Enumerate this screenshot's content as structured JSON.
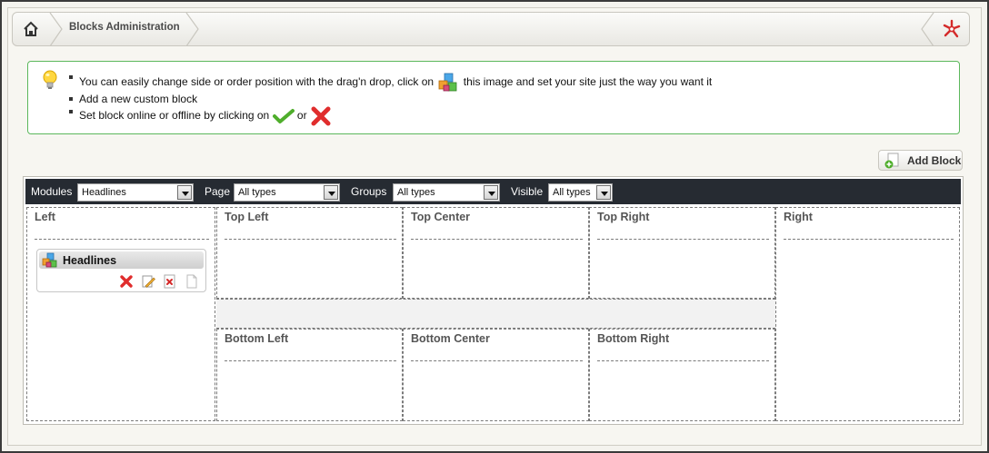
{
  "breadcrumb": {
    "title": "Blocks Administration"
  },
  "info": {
    "line1_before": "You can easily change side or order position with the drag'n drop, click on",
    "line1_after": "this image and set your site just the way you want it",
    "line2": "Add a new custom block",
    "line3_before": "Set block online or offline by clicking on",
    "line3_or": "or"
  },
  "toolbar": {
    "add_block_label": "Add Block"
  },
  "filters": {
    "modules_label": "Modules",
    "modules_value": "Headlines",
    "page_label": "Page",
    "page_value": "All types",
    "groups_label": "Groups",
    "groups_value": "All types",
    "visible_label": "Visible",
    "visible_value": "All types"
  },
  "zones": {
    "left": "Left",
    "top_left": "Top Left",
    "top_center": "Top Center",
    "top_right": "Top Right",
    "right": "Right",
    "bottom_left": "Bottom Left",
    "bottom_center": "Bottom Center",
    "bottom_right": "Bottom Right"
  },
  "block": {
    "title": "Headlines"
  },
  "icons": {
    "home": "home-icon",
    "settings": "settings-icon",
    "bulb": "lightbulb-icon",
    "blocks": "blocks-icon",
    "online": "checkmark-icon",
    "offline": "red-x-icon",
    "add": "add-page-icon",
    "edit": "edit-icon",
    "delete": "delete-icon",
    "clone": "page-icon"
  },
  "colors": {
    "filter_bar_bg": "#262b32",
    "info_border": "#5cb85c",
    "zone_border": "#7a7a7a"
  }
}
